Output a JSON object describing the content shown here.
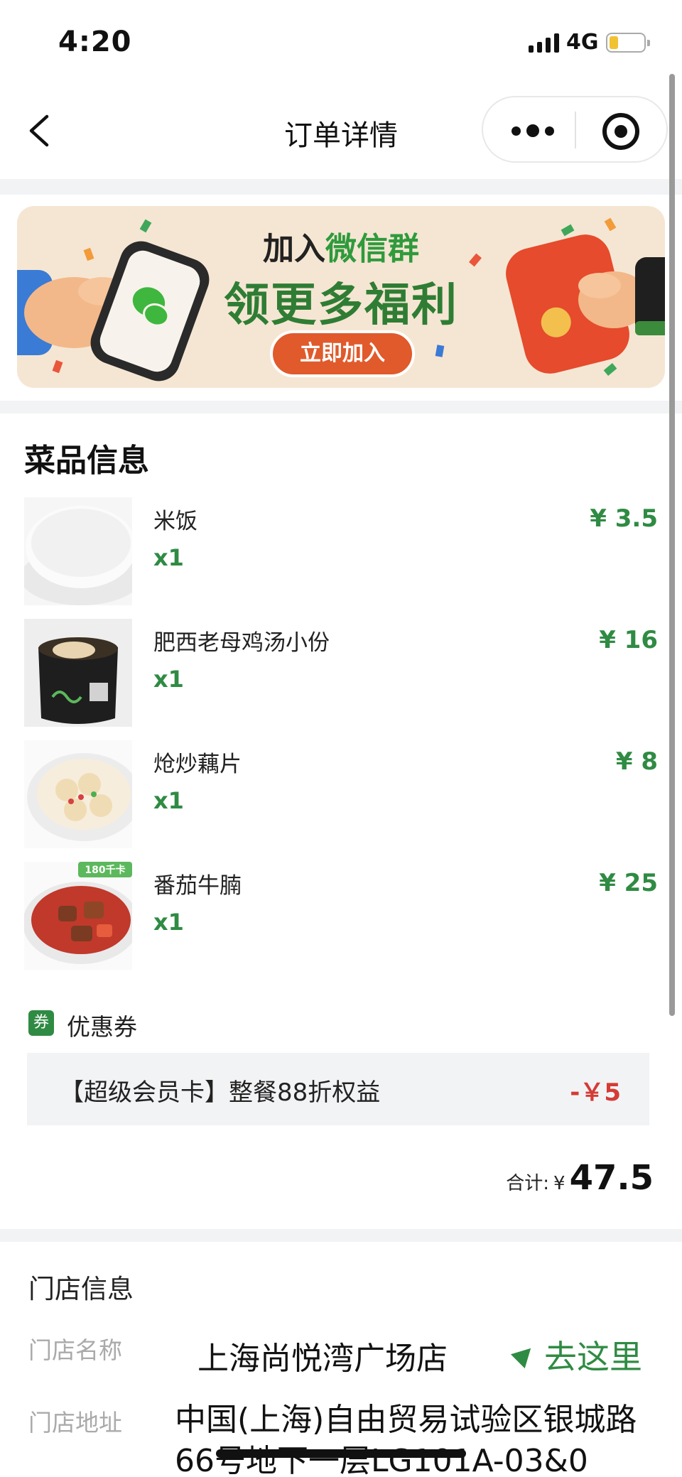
{
  "status_bar": {
    "time": "4:20",
    "network": "4G",
    "battery_level": 0.25
  },
  "nav": {
    "title": "订单详情"
  },
  "banner": {
    "line1_part1": "加入",
    "line1_part2": "微信群",
    "line2": "领更多福利",
    "button": "立即加入"
  },
  "dishes_section": {
    "title": "菜品信息"
  },
  "dishes": [
    {
      "name": "米饭",
      "qty": "x1",
      "price": "¥ 3.5",
      "image": "rice-bowl"
    },
    {
      "name": "肥西老母鸡汤小份",
      "qty": "x1",
      "price": "¥ 16",
      "image": "chicken-soup-pot"
    },
    {
      "name": "炝炒藕片",
      "qty": "x1",
      "price": "¥ 8",
      "image": "lotus-root-plate",
      "badge": ""
    },
    {
      "name": "番茄牛腩",
      "qty": "x1",
      "price": "¥ 25",
      "image": "tomato-beef-bowl",
      "badge": "180千卡"
    }
  ],
  "coupon": {
    "icon_text": "券",
    "label": "优惠券",
    "item_text": "【超级会员卡】整餐88折权益",
    "item_amount": "-￥5"
  },
  "total": {
    "label": "合计:",
    "currency": "¥",
    "value": "47.5"
  },
  "store": {
    "title": "门店信息",
    "name_label": "门店名称",
    "name": "上海尚悦湾广场店",
    "go_label": "去这里",
    "address_label": "门店地址",
    "address": "中国(上海)自由贸易试验区银城路66号地下一层LG101A-03&0"
  },
  "colors": {
    "accent_green": "#2f8b43",
    "discount_red": "#d43b35",
    "banner_bg": "#f5e6d3"
  }
}
